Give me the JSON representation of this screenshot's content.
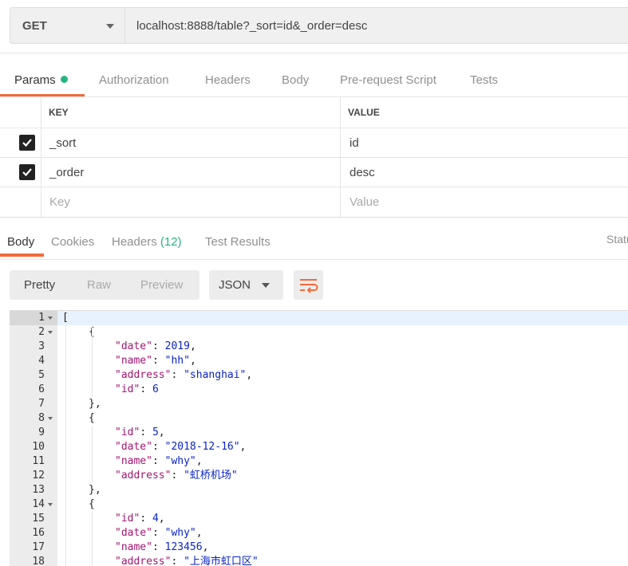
{
  "request": {
    "method": "GET",
    "url": "localhost:8888/table?_sort=id&_order=desc"
  },
  "request_tabs": [
    "Params",
    "Authorization",
    "Headers",
    "Body",
    "Pre-request Script",
    "Tests"
  ],
  "params": {
    "headers": {
      "key": "KEY",
      "value": "VALUE"
    },
    "rows": [
      {
        "checked": true,
        "key": "_sort",
        "value": "id"
      },
      {
        "checked": true,
        "key": "_order",
        "value": "desc"
      }
    ],
    "placeholder_key": "Key",
    "placeholder_value": "Value"
  },
  "response_tabs": {
    "body": "Body",
    "cookies": "Cookies",
    "headers": "Headers",
    "headers_count": "(12)",
    "test_results": "Test Results",
    "status": "Status"
  },
  "toolbar": {
    "pretty": "Pretty",
    "raw": "Raw",
    "preview": "Preview",
    "format": "JSON"
  },
  "code_lines": [
    {
      "n": "1",
      "fold": true,
      "indent": 0,
      "text": "["
    },
    {
      "n": "2",
      "fold": true,
      "indent": 1,
      "text": "{"
    },
    {
      "n": "3",
      "indent": 2,
      "key": "\"date\"",
      "val": "2019",
      "vtype": "n",
      "comma": ","
    },
    {
      "n": "4",
      "indent": 2,
      "key": "\"name\"",
      "val": "\"hh\"",
      "vtype": "s",
      "comma": ","
    },
    {
      "n": "5",
      "indent": 2,
      "key": "\"address\"",
      "val": "\"shanghai\"",
      "vtype": "s",
      "comma": ","
    },
    {
      "n": "6",
      "indent": 2,
      "key": "\"id\"",
      "val": "6",
      "vtype": "n",
      "comma": ""
    },
    {
      "n": "7",
      "indent": 1,
      "text": "},"
    },
    {
      "n": "8",
      "fold": true,
      "indent": 1,
      "text": "{"
    },
    {
      "n": "9",
      "indent": 2,
      "key": "\"id\"",
      "val": "5",
      "vtype": "n",
      "comma": ","
    },
    {
      "n": "10",
      "indent": 2,
      "key": "\"date\"",
      "val": "\"2018-12-16\"",
      "vtype": "s",
      "comma": ","
    },
    {
      "n": "11",
      "indent": 2,
      "key": "\"name\"",
      "val": "\"why\"",
      "vtype": "s",
      "comma": ","
    },
    {
      "n": "12",
      "indent": 2,
      "key": "\"address\"",
      "val": "\"虹桥机场\"",
      "vtype": "s",
      "comma": ""
    },
    {
      "n": "13",
      "indent": 1,
      "text": "},"
    },
    {
      "n": "14",
      "fold": true,
      "indent": 1,
      "text": "{"
    },
    {
      "n": "15",
      "indent": 2,
      "key": "\"id\"",
      "val": "4",
      "vtype": "n",
      "comma": ","
    },
    {
      "n": "16",
      "indent": 2,
      "key": "\"date\"",
      "val": "\"why\"",
      "vtype": "s",
      "comma": ","
    },
    {
      "n": "17",
      "indent": 2,
      "key": "\"name\"",
      "val": "123456",
      "vtype": "n",
      "comma": ","
    },
    {
      "n": "18",
      "indent": 2,
      "key": "\"address\"",
      "val": "\"上海市虹口区\"",
      "vtype": "s",
      "comma": ""
    }
  ],
  "colors": {
    "accent": "#f26b3a",
    "green": "#26b47f",
    "json_key": "#a31572",
    "json_value": "#0b24c8"
  },
  "icons": {
    "wrap": "wrap-lines-icon",
    "check": "checkbox-icon",
    "caret": "chevron-down-icon"
  }
}
